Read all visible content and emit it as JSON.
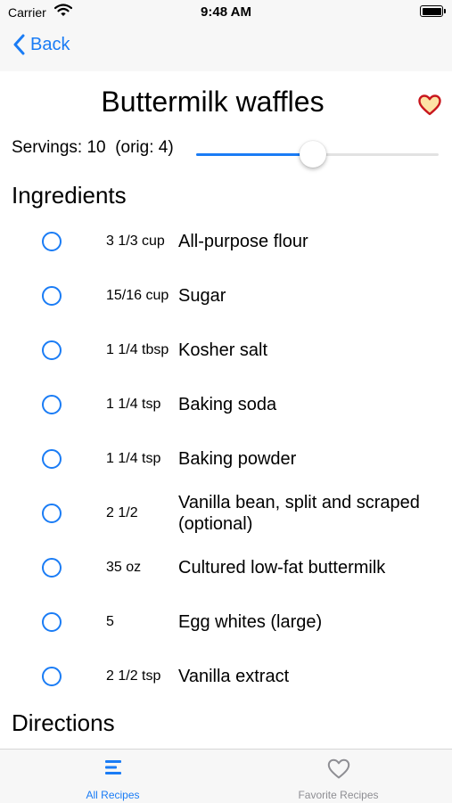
{
  "status": {
    "carrier": "Carrier",
    "time": "9:48 AM"
  },
  "nav": {
    "back_label": "Back"
  },
  "recipe": {
    "title": "Buttermilk waffles",
    "favorite": true,
    "servings_label": "Servings: 10",
    "orig_label": "(orig: 4)",
    "servings_slider_fraction": 0.48
  },
  "ingredients_heading": "Ingredients",
  "ingredients": [
    {
      "qty": "3 1/3 cup",
      "name": "All-purpose flour",
      "checked": false
    },
    {
      "qty": "15/16 cup",
      "name": "Sugar",
      "checked": false
    },
    {
      "qty": "1 1/4 tbsp",
      "name": "Kosher salt",
      "checked": false
    },
    {
      "qty": "1 1/4 tsp",
      "name": "Baking soda",
      "checked": false
    },
    {
      "qty": "1 1/4 tsp",
      "name": "Baking powder",
      "checked": false
    },
    {
      "qty": "2 1/2",
      "name": "Vanilla bean, split and scraped (optional)",
      "checked": false
    },
    {
      "qty": "35 oz",
      "name": "Cultured low-fat buttermilk",
      "checked": false
    },
    {
      "qty": "5",
      "name": "Egg whites (large)",
      "checked": false
    },
    {
      "qty": "2 1/2 tsp",
      "name": "Vanilla extract",
      "checked": false
    }
  ],
  "directions_heading": "Directions",
  "tabs": [
    {
      "label": "All Recipes",
      "icon": "list-icon",
      "active": true
    },
    {
      "label": "Favorite Recipes",
      "icon": "heart-outline-icon",
      "active": false
    }
  ],
  "colors": {
    "accent": "#1a7cf5",
    "heart_fill": "#fde2a5",
    "heart_stroke": "#c8161d",
    "inactive": "#8e8e93"
  }
}
